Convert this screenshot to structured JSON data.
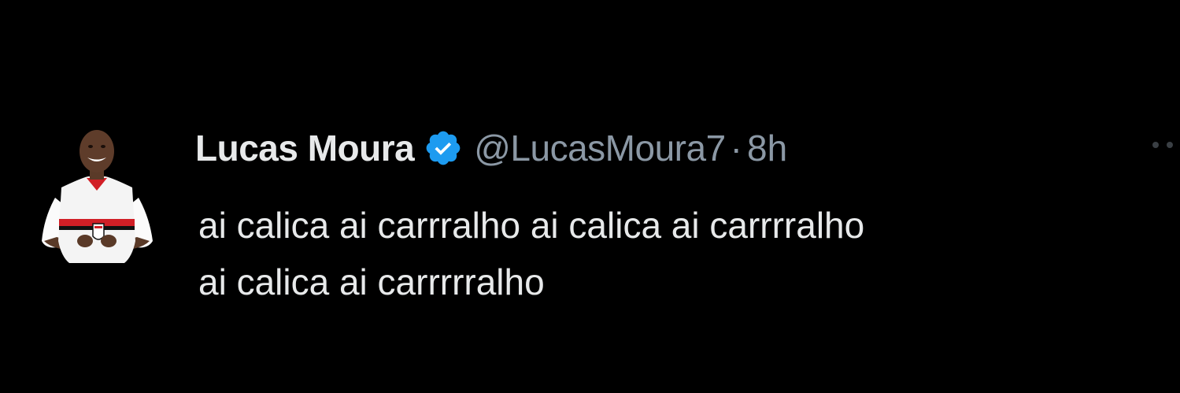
{
  "tweet": {
    "author": {
      "display_name": "Lucas Moura",
      "handle": "@LucasMoura7",
      "verified": true,
      "verified_color": "#1d9bf0"
    },
    "separator": "·",
    "time": "8h",
    "body_lines": [
      "ai calica ai carrralho ai calica ai carrrralho",
      "ai calica ai carrrrralho"
    ],
    "more_icon": "more-dots-icon",
    "avatar_icon": "avatar-player-photo"
  },
  "colors": {
    "background": "#000000",
    "primary_text": "#e7e9ea",
    "secondary_text": "#8b98a5",
    "verified_badge": "#1d9bf0"
  }
}
